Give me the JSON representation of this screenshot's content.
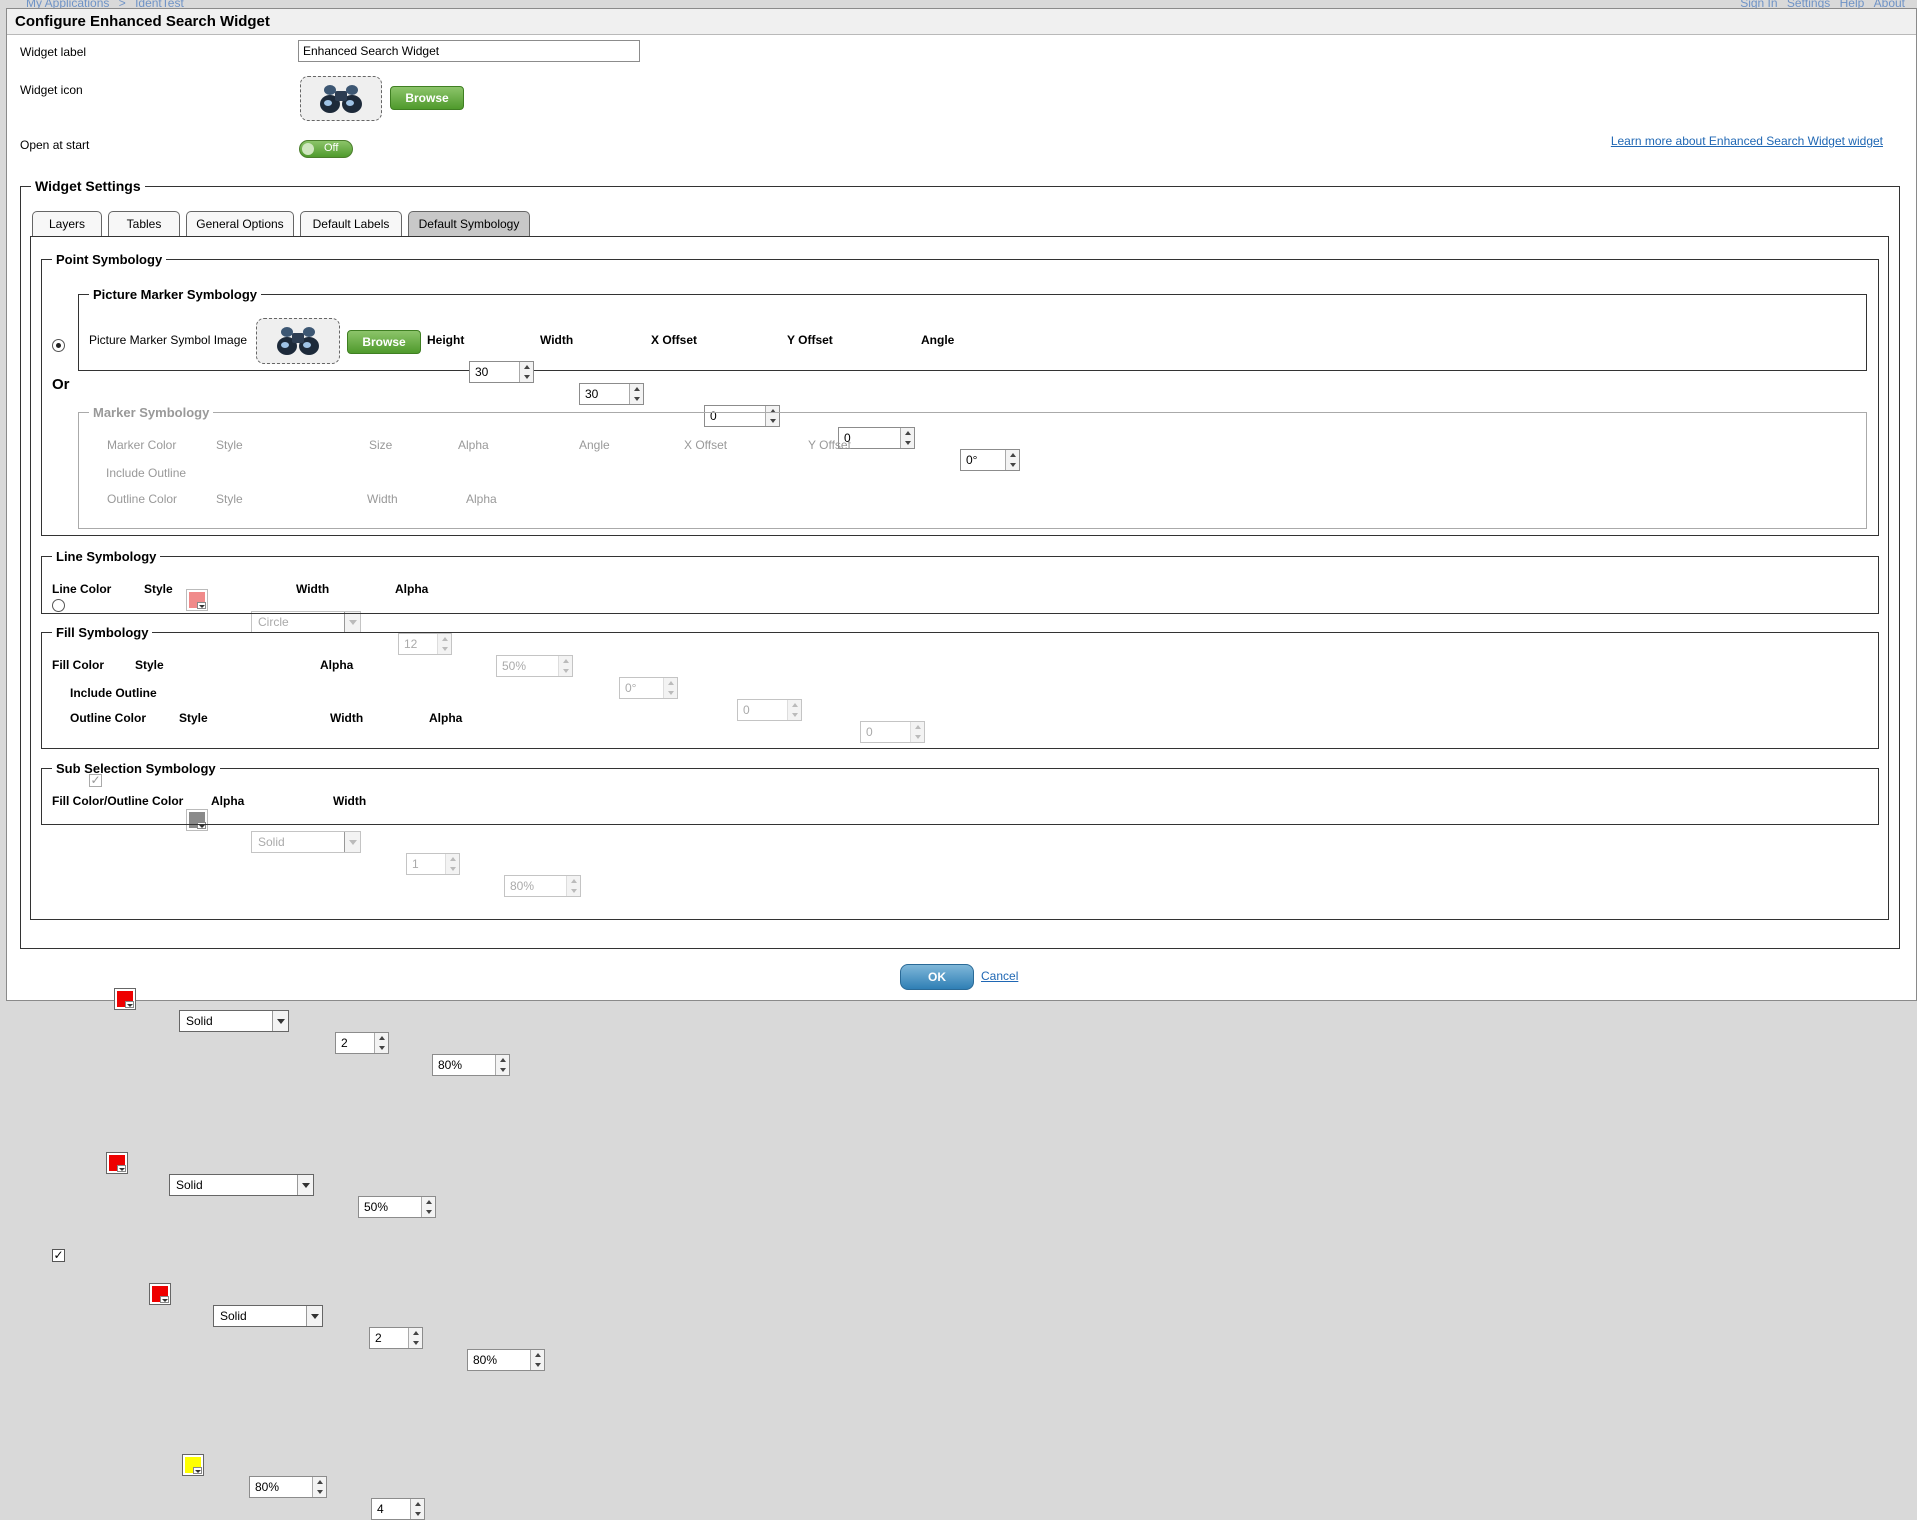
{
  "topnav": {
    "breadcrumb_apps": "My Applications",
    "breadcrumb_sep": ">",
    "breadcrumb_app": "IdentTest",
    "sign_in": "Sign In",
    "settings": "Settings",
    "help": "Help",
    "about": "About"
  },
  "dialog": {
    "title": "Configure Enhanced Search Widget",
    "widget_label_label": "Widget label",
    "widget_label_value": "Enhanced Search Widget",
    "widget_icon_label": "Widget icon",
    "browse": "Browse",
    "open_at_start_label": "Open at start",
    "open_at_start_toggle": "Off",
    "learn_more": "Learn more about Enhanced Search Widget widget",
    "settings_legend": "Widget Settings",
    "ok": "OK",
    "cancel": "Cancel"
  },
  "tabs": [
    "Layers",
    "Tables",
    "General Options",
    "Default Labels",
    "Default Symbology"
  ],
  "point": {
    "legend": "Point Symbology",
    "picture_legend": "Picture Marker Symbology",
    "picture_image_label": "Picture Marker Symbol Image",
    "browse": "Browse",
    "height_label": "Height",
    "height": "30",
    "width_label": "Width",
    "width": "30",
    "xoffset_label": "X Offset",
    "xoffset": "0",
    "yoffset_label": "Y Offset",
    "yoffset": "0",
    "angle_label": "Angle",
    "angle": "0°",
    "or": "Or",
    "marker_legend": "Marker Symbology",
    "marker_color_label": "Marker Color",
    "style_label": "Style",
    "style": "Circle",
    "size_label": "Size",
    "size": "12",
    "alpha_label": "Alpha",
    "alpha": "50%",
    "m_angle_label": "Angle",
    "m_angle": "0°",
    "m_xoffset_label": "X Offset",
    "m_xoffset": "0",
    "m_yoffset_label": "Y Offset",
    "m_yoffset": "0",
    "include_outline": "Include Outline",
    "outline_color_label": "Outline Color",
    "outline_style_label": "Style",
    "outline_style": "Solid",
    "outline_width_label": "Width",
    "outline_width": "1",
    "outline_alpha_label": "Alpha",
    "outline_alpha": "80%"
  },
  "line": {
    "legend": "Line Symbology",
    "color_label": "Line Color",
    "style_label": "Style",
    "style": "Solid",
    "width_label": "Width",
    "width": "2",
    "alpha_label": "Alpha",
    "alpha": "80%"
  },
  "fill": {
    "legend": "Fill Symbology",
    "color_label": "Fill Color",
    "style_label": "Style",
    "style": "Solid",
    "alpha_label": "Alpha",
    "alpha": "50%",
    "include_outline": "Include Outline",
    "outline_color_label": "Outline Color",
    "outline_style_label": "Style",
    "outline_style": "Solid",
    "outline_width_label": "Width",
    "outline_width": "2",
    "outline_alpha_label": "Alpha",
    "outline_alpha": "80%"
  },
  "subsel": {
    "legend": "Sub Selection Symbology",
    "color_label": "Fill Color/Outline Color",
    "alpha_label": "Alpha",
    "alpha": "80%",
    "width_label": "Width",
    "width": "4"
  },
  "colors": {
    "red": "#ee0000",
    "red_disabled": "#f08a8a",
    "gray_disabled": "#8a8a8a",
    "yellow": "#ffff00",
    "green_button": "#5aa336",
    "ok_button": "#3a8cc0"
  },
  "icons": [
    "binoculars-icon",
    "radio-icon",
    "checkbox-icon",
    "color-swatch-icon",
    "dropdown-arrow-icon",
    "spinner-icon"
  ]
}
